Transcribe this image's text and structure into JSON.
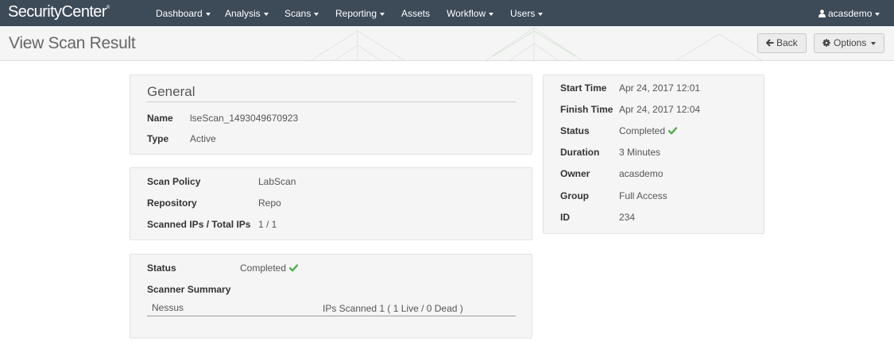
{
  "app": {
    "brand": "SecurityCenter",
    "brand_mark": "®"
  },
  "nav": {
    "items": [
      {
        "label": "Dashboard",
        "caret": true
      },
      {
        "label": "Analysis",
        "caret": true
      },
      {
        "label": "Scans",
        "caret": true
      },
      {
        "label": "Reporting",
        "caret": true
      },
      {
        "label": "Assets",
        "caret": false
      },
      {
        "label": "Workflow",
        "caret": true
      },
      {
        "label": "Users",
        "caret": true
      }
    ],
    "user": "acasdemo"
  },
  "header": {
    "title": "View Scan Result",
    "back_label": "Back",
    "options_label": "Options"
  },
  "general": {
    "title": "General",
    "name_label": "Name",
    "name_value": "lseScan_1493049670923",
    "type_label": "Type",
    "type_value": "Active"
  },
  "policy": {
    "policy_label": "Scan Policy",
    "policy_value": "LabScan",
    "repo_label": "Repository",
    "repo_value": "Repo",
    "ips_label": "Scanned IPs / Total IPs",
    "ips_value": "1 / 1"
  },
  "scan_status": {
    "status_label": "Status",
    "status_value": "Completed",
    "summary_label": "Scanner Summary",
    "scanner_name": "Nessus",
    "scanner_result": "IPs Scanned 1 ( 1 Live / 0 Dead )"
  },
  "details": {
    "start_label": "Start Time",
    "start_value": "Apr 24, 2017 12:01",
    "finish_label": "Finish Time",
    "finish_value": "Apr 24, 2017 12:04",
    "status_label": "Status",
    "status_value": "Completed",
    "duration_label": "Duration",
    "duration_value": "3 Minutes",
    "owner_label": "Owner",
    "owner_value": "acasdemo",
    "group_label": "Group",
    "group_value": "Full Access",
    "id_label": "ID",
    "id_value": "234"
  },
  "colors": {
    "nav_bg": "#3d4a58",
    "success": "#4cae4c",
    "panel_bg": "#f5f5f5"
  }
}
